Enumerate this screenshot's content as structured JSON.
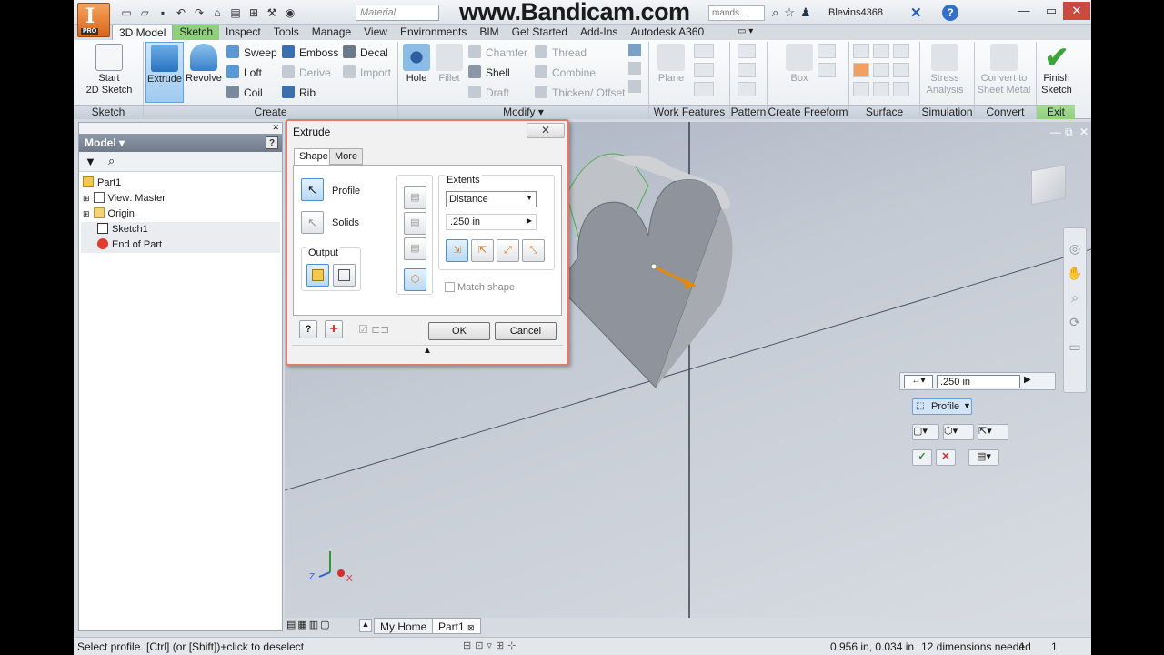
{
  "app": {
    "logo_letter": "I",
    "logo_sub": "PRO",
    "material_placeholder": "Material",
    "watermark": "www.Bandicam.com",
    "command_search": "mands...",
    "user": "Blevins4368",
    "help": "?"
  },
  "tabs": [
    "3D Model",
    "Sketch",
    "Inspect",
    "Tools",
    "Manage",
    "View",
    "Environments",
    "BIM",
    "Get Started",
    "Add-Ins",
    "Autodesk A360"
  ],
  "ribbon": {
    "start_sketch": "Start\n2D Sketch",
    "extrude": "Extrude",
    "revolve": "Revolve",
    "sweep": "Sweep",
    "emboss": "Emboss",
    "decal": "Decal",
    "loft": "Loft",
    "derive": "Derive",
    "import": "Import",
    "coil": "Coil",
    "rib": "Rib",
    "hole": "Hole",
    "fillet": "Fillet",
    "chamfer": "Chamfer",
    "thread": "Thread",
    "shell": "Shell",
    "combine": "Combine",
    "draft": "Draft",
    "thicken": "Thicken/ Offset",
    "plane": "Plane",
    "box": "Box",
    "stress": "Stress\nAnalysis",
    "convert_sheet": "Convert to\nSheet Metal",
    "finish_sketch": "Finish\nSketch",
    "panels": [
      "Sketch",
      "Create",
      "Modify",
      "Work Features",
      "Pattern",
      "Create Freeform",
      "Surface",
      "Simulation",
      "Convert",
      "Exit"
    ]
  },
  "browser": {
    "title": "Model",
    "items": [
      "Part1",
      "View: Master",
      "Origin",
      "Sketch1",
      "End of Part"
    ]
  },
  "dialog": {
    "title": "Extrude",
    "tab_shape": "Shape",
    "tab_more": "More",
    "profile": "Profile",
    "solids": "Solids",
    "output": "Output",
    "extents": "Extents",
    "extent_type": "Distance",
    "distance": ".250 in",
    "match_shape": "Match shape",
    "ok": "OK",
    "cancel": "Cancel"
  },
  "minitoolbar": {
    "distance": ".250 in",
    "profile": "Profile"
  },
  "doc_tabs": [
    "My Home",
    "Part1"
  ],
  "status": {
    "message": "Select profile. [Ctrl] (or [Shift])+click to deselect",
    "coords": "0.956 in, 0.034 in",
    "dims": "12 dimensions needed",
    "n1": "1",
    "n2": "1"
  },
  "colors": {
    "accent_blue": "#3470c8",
    "sketch_green": "#8fd07b",
    "dialog_border": "#e07a6a",
    "finish_check": "#3aa53a"
  }
}
